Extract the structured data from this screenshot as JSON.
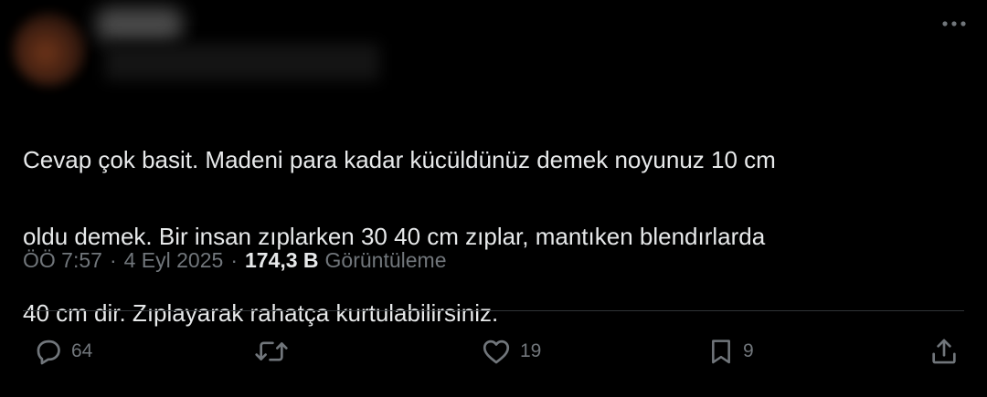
{
  "tweet": {
    "text_lines": [
      "Cevap çok basit. Madeni para kadar kücüldünüz demek noyunuz 10 cm",
      "oldu demek. Bir insan zıplarken 30 40 cm zıplar, mantıken blendırlarda",
      "40 cm dir. Zıplayarak rahatça kurtulabilirsiniz."
    ],
    "time": "ÖÖ 7:57",
    "separator": "·",
    "date": "4 Eyl 2025",
    "views_count": "174,3 B",
    "views_label": "Görüntüleme"
  },
  "actions": {
    "replies": "64",
    "retweets": "",
    "likes": "19",
    "bookmarks": "9"
  },
  "icons": {
    "more": "more-horizontal-icon",
    "reply": "speech-bubble-icon",
    "retweet": "retweet-arrows-icon",
    "like": "heart-icon",
    "bookmark": "bookmark-icon",
    "share": "share-upload-icon"
  },
  "colors": {
    "background": "#000000",
    "text_primary": "#e7e9ea",
    "text_secondary": "#71767b",
    "divider": "#2f3336"
  }
}
